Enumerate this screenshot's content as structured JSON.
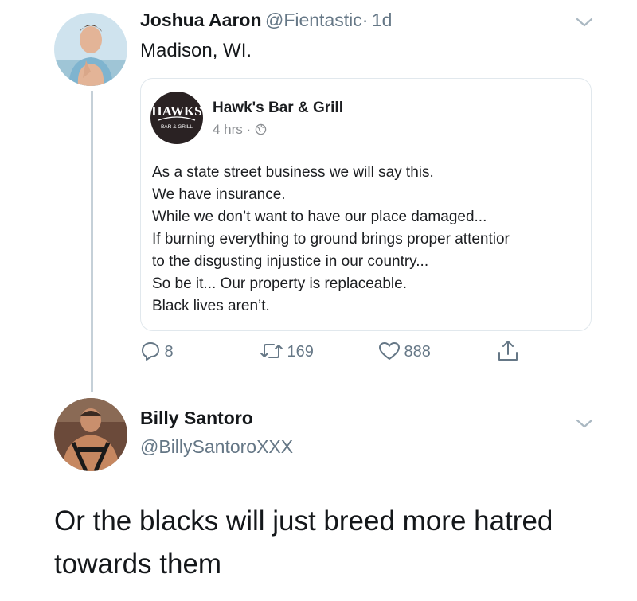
{
  "tweet": {
    "author_name": "Joshua Aaron",
    "author_handle": "@Fientastic",
    "separator": "·",
    "time": "1d",
    "text": "Madison, WI.",
    "quoted": {
      "page_name": "Hawk's Bar & Grill",
      "logo_text": "HAWKS",
      "logo_subtext": "BAR & GRILL",
      "time": "4 hrs ·",
      "lines": [
        "As a state street business we will say this.",
        "We have insurance.",
        "While we don’t want to have our place damaged...",
        "If burning everything to ground brings proper attentior",
        "to the disgusting injustice in our country...",
        "So be it... Our property is replaceable.",
        "Black lives aren’t."
      ]
    },
    "actions": {
      "replies": "8",
      "retweets": "169",
      "likes": "888"
    }
  },
  "reply": {
    "author_name": "Billy Santoro",
    "author_handle": "@BillySantoroXXX",
    "text_lines": [
      "Or the blacks will just breed more hatred",
      "towards them"
    ]
  },
  "colors": {
    "secondary_text": "#657786",
    "thread_line": "#c5d0d8",
    "card_border": "#e1e8ed"
  }
}
